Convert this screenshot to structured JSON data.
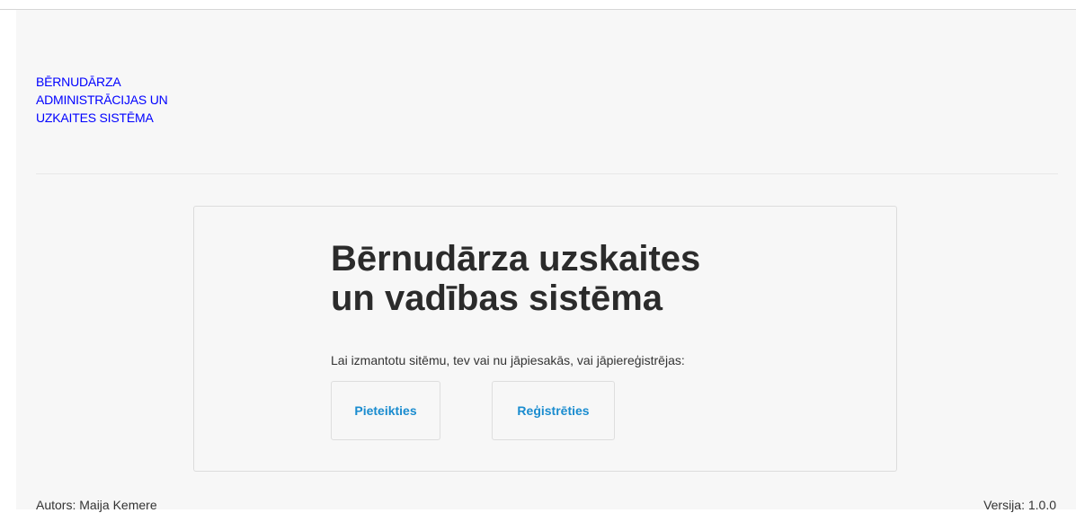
{
  "header": {
    "brand_line1": "BĒRNUDĀRZA",
    "brand_line2": "ADMINISTRĀCIJAS UN",
    "brand_line3": "UZKAITES SISTĒMA"
  },
  "main": {
    "title_line1": "Bērnudārza uzskaites",
    "title_line2": "un vadības sistēma",
    "lead": "Lai izmantotu sitēmu, tev vai nu jāpiesakās, vai jāpiereģistrējas:",
    "login_label": "Pieteikties",
    "register_label": "Reģistrēties"
  },
  "footer": {
    "author": "Autors: Maija Kemere",
    "version": "Versija: 1.0.0"
  },
  "colors": {
    "brand_link": "#0000ff",
    "button_text": "#1a8ccf",
    "background": "#f7f7f7"
  }
}
